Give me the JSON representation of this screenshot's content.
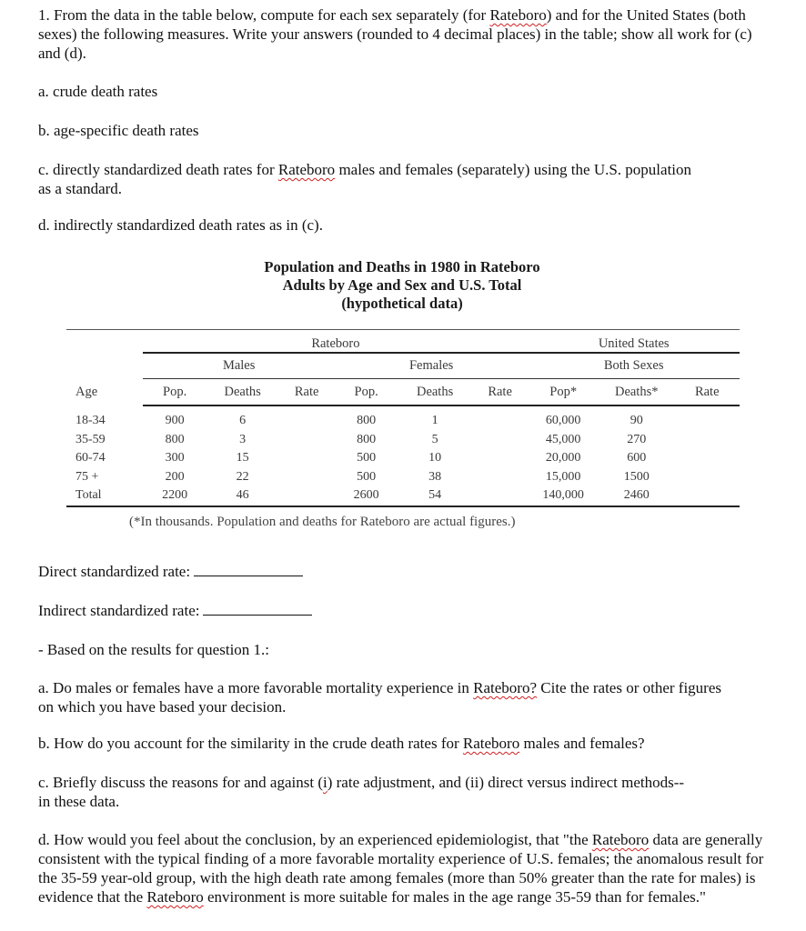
{
  "question": {
    "intro": [
      "1. From the data in the table below, compute for each sex separately (for ",
      "Rateboro",
      ") and for the United States (both sexes) the following measures. Write your answers (rounded to 4 decimal places) in the table; show all work for (c) and (d)."
    ],
    "item_a": "a. crude death rates",
    "item_b": "b. age-specific death rates",
    "item_c": [
      "c. directly standardized death rates for ",
      "Rateboro",
      " males and females (separately) using the U.S. population as a standard."
    ],
    "item_d": "d. indirectly standardized death rates as in (c)."
  },
  "table": {
    "title_lines": [
      "Population and Deaths in 1980 in Rateboro",
      "Adults by Age and Sex and U.S. Total",
      "(hypothetical data)"
    ],
    "group_rateboro": "Rateboro",
    "group_us": "United States",
    "sub_males": "Males",
    "sub_females": "Females",
    "sub_both": "Both Sexes",
    "columns": [
      "Age",
      "Pop.",
      "Deaths",
      "Rate",
      "Pop.",
      "Deaths",
      "Rate",
      "Pop*",
      "Deaths*",
      "Rate"
    ],
    "rows": [
      {
        "age": "18-34",
        "m_pop": "900",
        "m_deaths": "6",
        "m_rate": "",
        "f_pop": "800",
        "f_deaths": "1",
        "f_rate": "",
        "us_pop": "60,000",
        "us_deaths": "90",
        "us_rate": ""
      },
      {
        "age": "35-59",
        "m_pop": "800",
        "m_deaths": "3",
        "m_rate": "",
        "f_pop": "800",
        "f_deaths": "5",
        "f_rate": "",
        "us_pop": "45,000",
        "us_deaths": "270",
        "us_rate": ""
      },
      {
        "age": "60-74",
        "m_pop": "300",
        "m_deaths": "15",
        "m_rate": "",
        "f_pop": "500",
        "f_deaths": "10",
        "f_rate": "",
        "us_pop": "20,000",
        "us_deaths": "600",
        "us_rate": ""
      },
      {
        "age": "75 +",
        "m_pop": "200",
        "m_deaths": "22",
        "m_rate": "",
        "f_pop": "500",
        "f_deaths": "38",
        "f_rate": "",
        "us_pop": "15,000",
        "us_deaths": "1500",
        "us_rate": ""
      },
      {
        "age": "Total",
        "m_pop": "2200",
        "m_deaths": "46",
        "m_rate": "",
        "f_pop": "2600",
        "f_deaths": "54",
        "f_rate": "",
        "us_pop": "140,000",
        "us_deaths": "2460",
        "us_rate": ""
      }
    ],
    "footnote": "(*In thousands.  Population and deaths for Rateboro are actual figures.)"
  },
  "answers": {
    "direct_label": "Direct standardized rate:",
    "indirect_label": "Indirect standardized rate:"
  },
  "followup": {
    "lead": "- Based on the results for question 1.:",
    "a": [
      "a. Do males or females have a more favorable mortality experience in ",
      "Rateboro?",
      " Cite the rates or other figures on which you have based your decision."
    ],
    "b": [
      "b. How do you account for the similarity in the crude death rates for ",
      "Rateboro",
      " males and females?"
    ],
    "c": [
      "c. Briefly discuss the reasons for and against (",
      "i",
      ") rate adjustment, and (ii) direct versus indirect methods--in these data."
    ],
    "d": [
      "d. How would you feel about the conclusion, by an experienced epidemiologist, that \"the ",
      "Rateboro",
      " data are generally consistent with the typical finding of a more favorable mortality experience of U.S. females; the anomalous result for the 35-59 year-old group, with the high death rate among females (more than 50% greater than the rate for males) is evidence that the ",
      "Rateboro",
      " environment is more suitable for males in the age range 35-59 than for females.\""
    ]
  }
}
